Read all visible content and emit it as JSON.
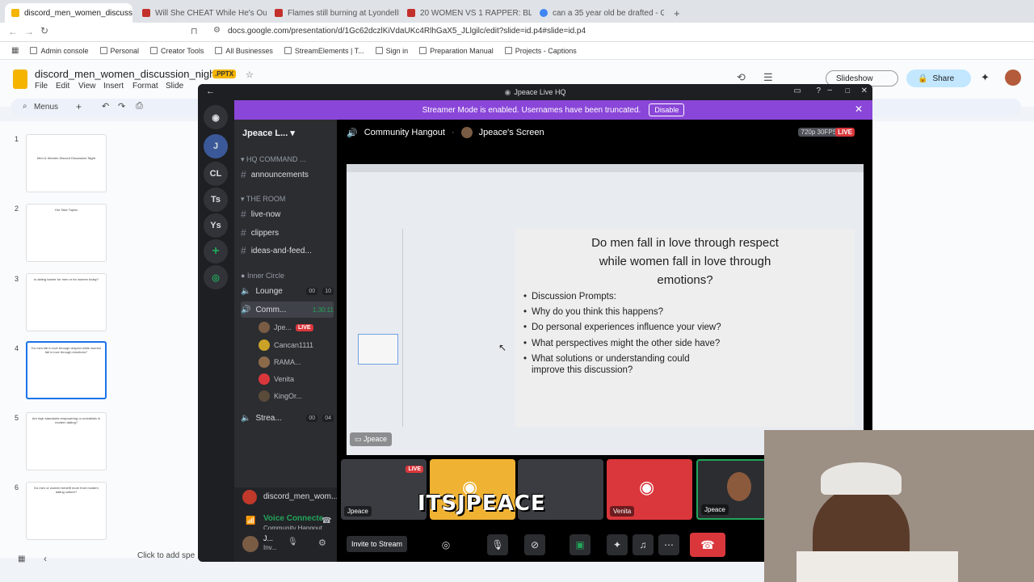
{
  "browser": {
    "tabs": [
      {
        "title": "discord_men_women_discussio",
        "active": true
      },
      {
        "title": "Will She CHEAT While He's Out Of To"
      },
      {
        "title": "Flames still burning at LyondellBasell"
      },
      {
        "title": "20 WOMEN VS 1 RAPPER: BLOODHO"
      },
      {
        "title": "can a 35 year old be drafted - Googl"
      }
    ],
    "url": "docs.google.com/presentation/d/1Gc62dczlKiVdaUKc4RlhGaX5_JLlgilc/edit?slide=id.p4#slide=id.p4",
    "bookmarks": [
      "Admin console",
      "Personal",
      "Creator Tools",
      "All Businesses",
      "StreamElements | T...",
      "Sign in",
      "Preparation Manual",
      "Projects - Captions"
    ]
  },
  "slides": {
    "doc_title": "discord_men_women_discussion_night",
    "badge": ".PPTX",
    "menus": [
      "File",
      "Edit",
      "View",
      "Insert",
      "Format",
      "Slide"
    ],
    "search_label": "Menus",
    "slideshow_label": "Slideshow",
    "share_label": "Share",
    "speaker_notes": "Click to add spe",
    "thumbnails": [
      {
        "num": "1",
        "text": "Men & Women Discord Discussion Night"
      },
      {
        "num": "2",
        "text": "Hot Take Topics"
      },
      {
        "num": "3",
        "text": "Is dating harder for men or for women today?"
      },
      {
        "num": "4",
        "text": "Do men fall in love through respect while women fall in love through emotions?"
      },
      {
        "num": "5",
        "text": "Are high standards empowering or unrealistic in modern dating?"
      },
      {
        "num": "6",
        "text": "Do men or women benefit more from modern dating culture?"
      }
    ]
  },
  "discord": {
    "window_title": "Jpeace Live HQ",
    "banner_text": "Streamer Mode is enabled. Usernames have been truncated.",
    "disable_label": "Disable",
    "servers": [
      "CL",
      "Ts",
      "Ys"
    ],
    "server_name": "Jpeace L...",
    "categories": {
      "hq": "HQ COMMAND ...",
      "room": "THE ROOM",
      "inner": "Inner Circle"
    },
    "channels": {
      "announcements": "announcements",
      "live_now": "live-now",
      "clippers": "clippers",
      "ideas": "ideas-and-feed...",
      "lounge": "Lounge",
      "lounge_a": "00",
      "lounge_b": "10",
      "community": "Comm...",
      "community_time": "1:30:11",
      "stream_ch": "Strea...",
      "stream_a": "00",
      "stream_b": "04"
    },
    "voice_users": [
      {
        "name": "Jpe...",
        "live": "LIVE"
      },
      {
        "name": "Cancan1111"
      },
      {
        "name": "RAMA..."
      },
      {
        "name": "Venita"
      },
      {
        "name": "KingOr..."
      }
    ],
    "voice_panel": {
      "server": "discord_men_wom...",
      "status": "Voice Connecte",
      "channel": "Community Hangout",
      "user": "J...",
      "user_sub": "Inv..."
    },
    "header": {
      "channel": "Community Hangout",
      "screen": "Jpeace's Screen",
      "quality": "720p 30FPS",
      "live": "LIVE"
    },
    "stream_label": "Jpeace",
    "slide": {
      "title_lines": [
        "Do men fall in love through respect",
        "while women fall in love through",
        "emotions?"
      ],
      "prompts": [
        "Discussion Prompts:",
        "Why do you think this happens?",
        "Do personal experiences influence your view?",
        "What perspectives might the other side have?",
        "What solutions or understanding could",
        "improve this discussion?"
      ]
    },
    "tiles": [
      {
        "label": "Jpeace",
        "live": "LIVE",
        "color": "#3a3c42"
      },
      {
        "label": "",
        "color": "#f0b232"
      },
      {
        "label": "",
        "color": "#3a3c42"
      },
      {
        "label": "Venita",
        "color": "#da373c"
      },
      {
        "label": "Jpeace",
        "color": "#2b2d31"
      }
    ],
    "overlay_name": "ITSJPEACE",
    "invite_label": "Invite to Stream"
  }
}
